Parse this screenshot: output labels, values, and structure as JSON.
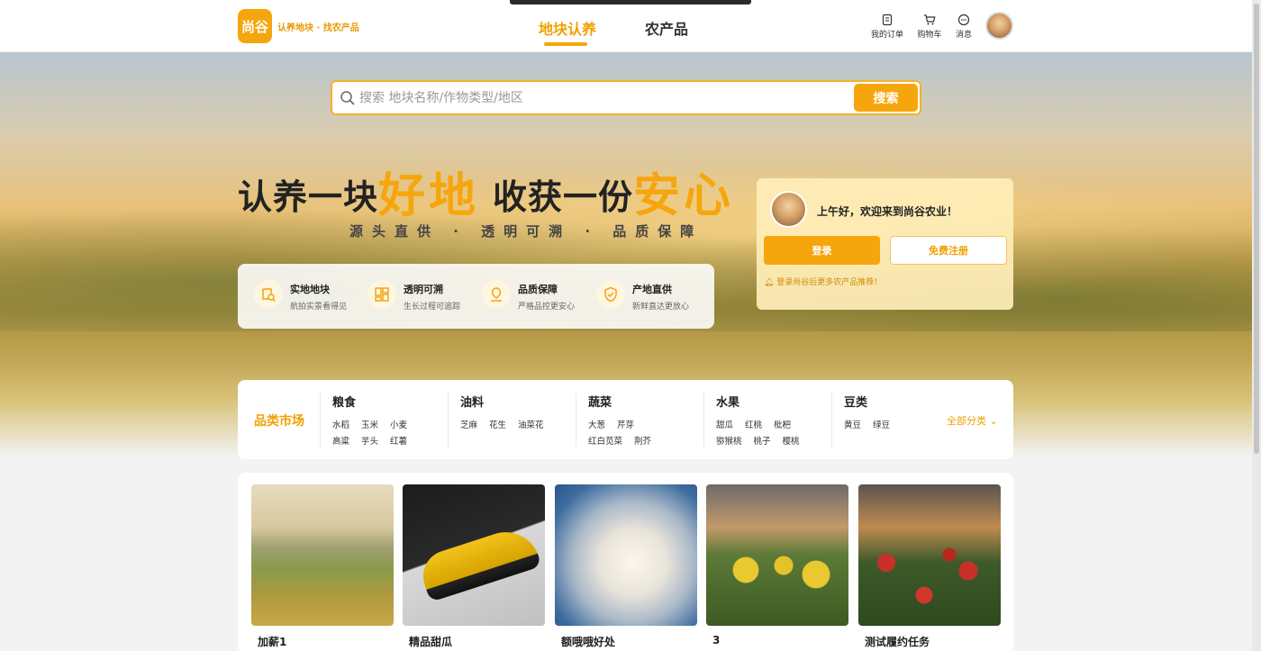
{
  "header": {
    "logo_text": "尚谷",
    "slogan": "认养地块 · 找农产品",
    "nav": [
      {
        "label": "地块认养",
        "active": true
      },
      {
        "label": "农产品",
        "active": false
      }
    ],
    "icons": [
      {
        "label": "我的订单",
        "icon": "clipboard-icon"
      },
      {
        "label": "购物车",
        "icon": "cart-icon"
      },
      {
        "label": "消息",
        "icon": "message-icon"
      }
    ]
  },
  "search": {
    "placeholder": "搜索 地块名称/作物类型/地区",
    "button": "搜索"
  },
  "hero": {
    "title1_prefix": "认养一块",
    "title1_emph": "好地",
    "title2_prefix": "收获一份",
    "title2_emph": "安心",
    "subtitle": "源头直供 · 透明可溯 · 品质保障"
  },
  "features": [
    {
      "title": "实地地块",
      "desc": "航拍实景看得见",
      "icon": "search-land-icon"
    },
    {
      "title": "透明可溯",
      "desc": "生长过程可追踪",
      "icon": "trace-icon"
    },
    {
      "title": "品质保障",
      "desc": "严格品控更安心",
      "icon": "quality-icon"
    },
    {
      "title": "产地直供",
      "desc": "新鲜直达更放心",
      "icon": "shield-icon"
    }
  ],
  "login": {
    "greeting": "上午好，欢迎来到尚谷农业！",
    "login_button": "登录",
    "register_button": "免费注册",
    "tip": "登录尚谷后更多农产品推荐！"
  },
  "categories": {
    "title": "品类市场",
    "all_label": "全部分类",
    "groups": [
      {
        "name": "粮食",
        "items": [
          "水稻",
          "玉米",
          "小麦",
          "高粱",
          "芋头",
          "红薯"
        ]
      },
      {
        "name": "油料",
        "items": [
          "芝麻",
          "花生",
          "油菜花"
        ]
      },
      {
        "name": "蔬菜",
        "items": [
          "大葱",
          "芹芽",
          "红白苋菜",
          "荆芥"
        ]
      },
      {
        "name": "水果",
        "items": [
          "甜瓜",
          "红桃",
          "枇杷",
          "猕猴桃",
          "桃子",
          "樱桃"
        ]
      },
      {
        "name": "豆类",
        "items": [
          "黄豆",
          "绿豆"
        ]
      }
    ]
  },
  "products": [
    {
      "name": "加薪1"
    },
    {
      "name": "精品甜瓜"
    },
    {
      "name": "额哦哦好处"
    },
    {
      "name": "3"
    },
    {
      "name": "测试履约任务"
    }
  ],
  "colors": {
    "accent": "#f6a60d"
  }
}
